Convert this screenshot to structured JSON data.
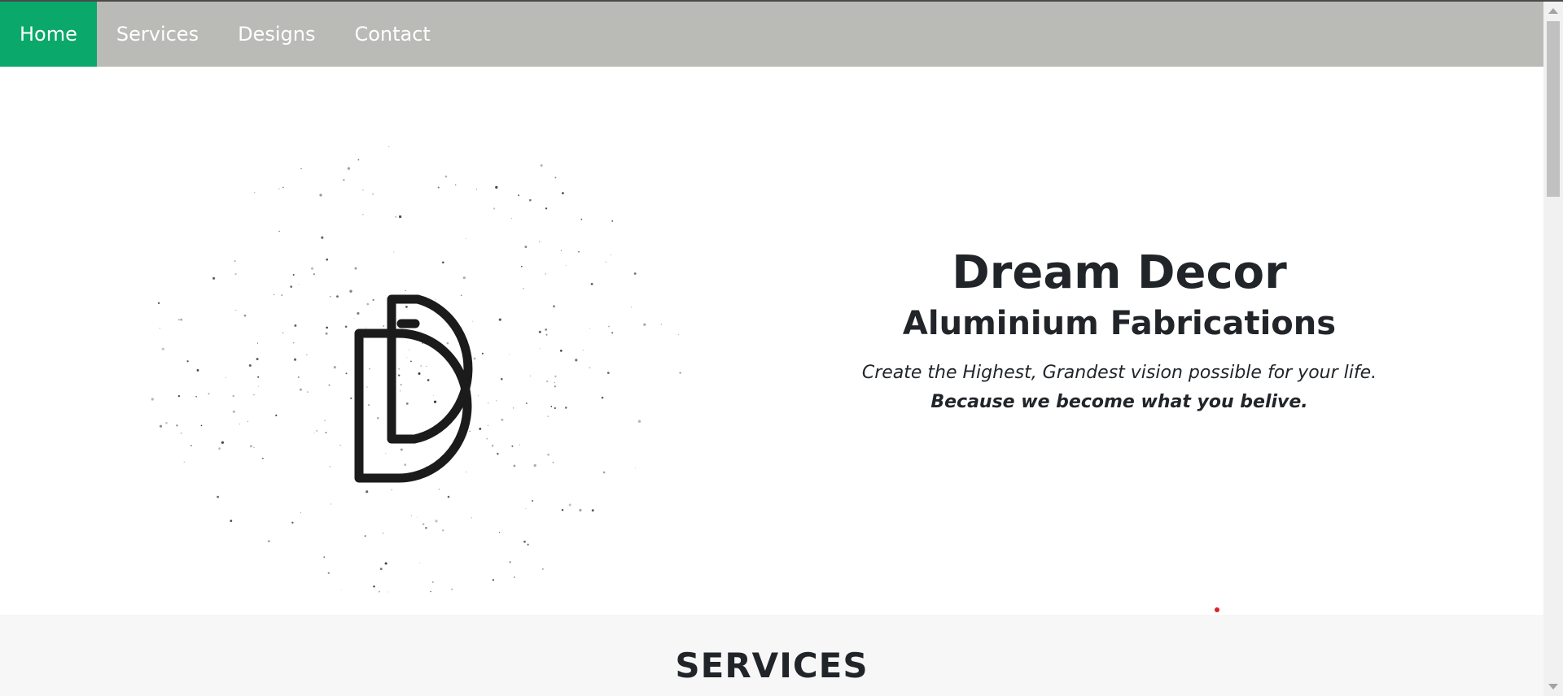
{
  "nav": {
    "items": [
      {
        "label": "Home",
        "active": true
      },
      {
        "label": "Services",
        "active": false
      },
      {
        "label": "Designs",
        "active": false
      },
      {
        "label": "Contact",
        "active": false
      }
    ]
  },
  "hero": {
    "logo_icon": "dream-decor-dd-logo",
    "title": "Dream Decor",
    "subtitle": "Aluminium Fabrications",
    "tagline": "Create the Highest, Grandest vision possible for your life.",
    "tagline_bold": "Because we become what you belive."
  },
  "services": {
    "title": "SERVICES"
  },
  "colors": {
    "nav_background": "#babbb6",
    "nav_active": "#0aa86a",
    "text": "#212529",
    "section_background": "#f7f7f8"
  }
}
